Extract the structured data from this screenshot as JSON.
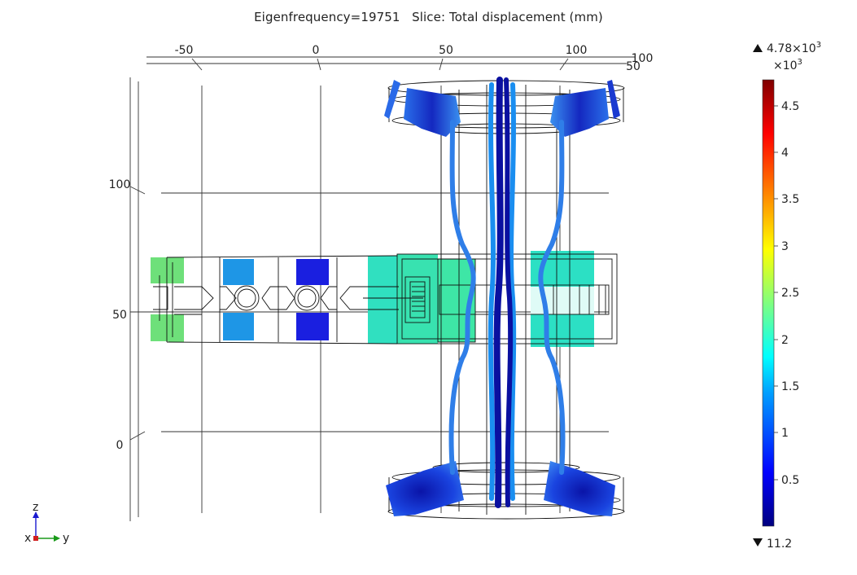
{
  "title": {
    "eigenfrequency": "Eigenfrequency=19751",
    "slice": "Slice: Total displacement (mm)"
  },
  "axes": {
    "y_ticks": [
      "-50",
      "0",
      "50",
      "100"
    ],
    "y_end_labels": [
      "100",
      "50"
    ],
    "z_ticks": [
      "100",
      "50",
      "0"
    ]
  },
  "colorbar": {
    "max_label": "4.78×10",
    "max_exp": "3",
    "multiplier": "×10",
    "multiplier_exp": "3",
    "ticks": [
      "4.5",
      "4",
      "3.5",
      "3",
      "2.5",
      "2",
      "1.5",
      "1",
      "0.5"
    ],
    "min_label": "11.2",
    "colormap": "rainbow"
  },
  "triad": {
    "z": "z",
    "y": "y",
    "x": "x"
  },
  "colors": {
    "dark_blue": "#1a1fb0",
    "blue": "#1f4fe0",
    "light_blue": "#1e96e6",
    "cyan": "#2ee0c9",
    "aqua_green": "#3ee6a8",
    "green": "#6ee07a"
  }
}
